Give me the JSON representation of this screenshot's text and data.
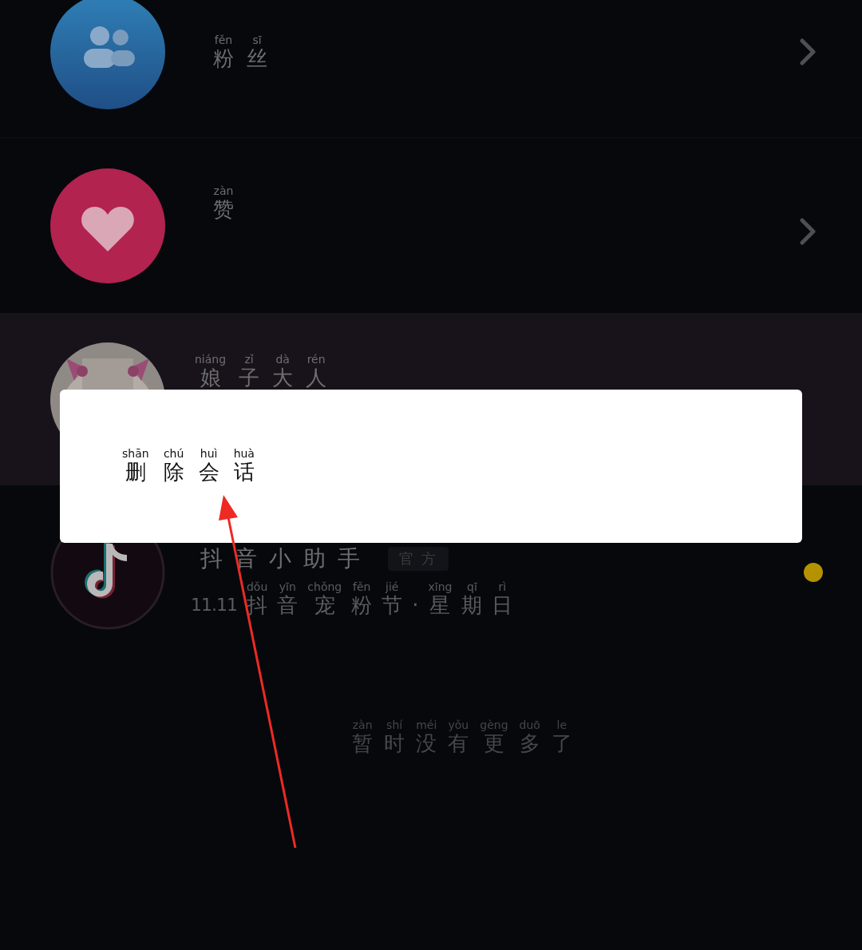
{
  "rows": [
    {
      "kind": "fans",
      "label": [
        {
          "py": "fěn",
          "ch": "粉"
        },
        {
          "py": "sī",
          "ch": "丝"
        }
      ],
      "chevron": true,
      "highlighted": false
    },
    {
      "kind": "likes",
      "label": [
        {
          "py": "zàn",
          "ch": "赞"
        }
      ],
      "chevron": true,
      "highlighted": false
    },
    {
      "kind": "chat",
      "label": [
        {
          "py": "niáng",
          "ch": "娘"
        },
        {
          "py": "zǐ",
          "ch": "子"
        },
        {
          "py": "dà",
          "ch": "大"
        },
        {
          "py": "rén",
          "ch": "人"
        }
      ],
      "chevron": false,
      "highlighted": true
    },
    {
      "kind": "assistant",
      "title": "抖音小助手",
      "tag": "官方",
      "subtitle": [
        {
          "ch": "11.11"
        },
        {
          "py": "dǒu",
          "ch": "抖"
        },
        {
          "py": "yīn",
          "ch": "音"
        },
        {
          "py": "chǒng",
          "ch": "宠"
        },
        {
          "py": "fěn",
          "ch": "粉"
        },
        {
          "py": "jié",
          "ch": "节"
        },
        {
          "ch": "·"
        },
        {
          "py": "xīng",
          "ch": "星"
        },
        {
          "py": "qī",
          "ch": "期"
        },
        {
          "py": "rì",
          "ch": "日"
        }
      ],
      "unread": true,
      "chevron": false,
      "highlighted": false
    }
  ],
  "empty_note": [
    {
      "py": "zàn",
      "ch": "暂"
    },
    {
      "py": "shí",
      "ch": "时"
    },
    {
      "py": "méi",
      "ch": "没"
    },
    {
      "py": "yǒu",
      "ch": "有"
    },
    {
      "py": "gèng",
      "ch": "更"
    },
    {
      "py": "duō",
      "ch": "多"
    },
    {
      "py": "le",
      "ch": "了"
    }
  ],
  "dialog": {
    "option": [
      {
        "py": "shān",
        "ch": "删"
      },
      {
        "py": "chú",
        "ch": "除"
      },
      {
        "py": "huì",
        "ch": "会"
      },
      {
        "py": "huà",
        "ch": "话"
      }
    ]
  }
}
